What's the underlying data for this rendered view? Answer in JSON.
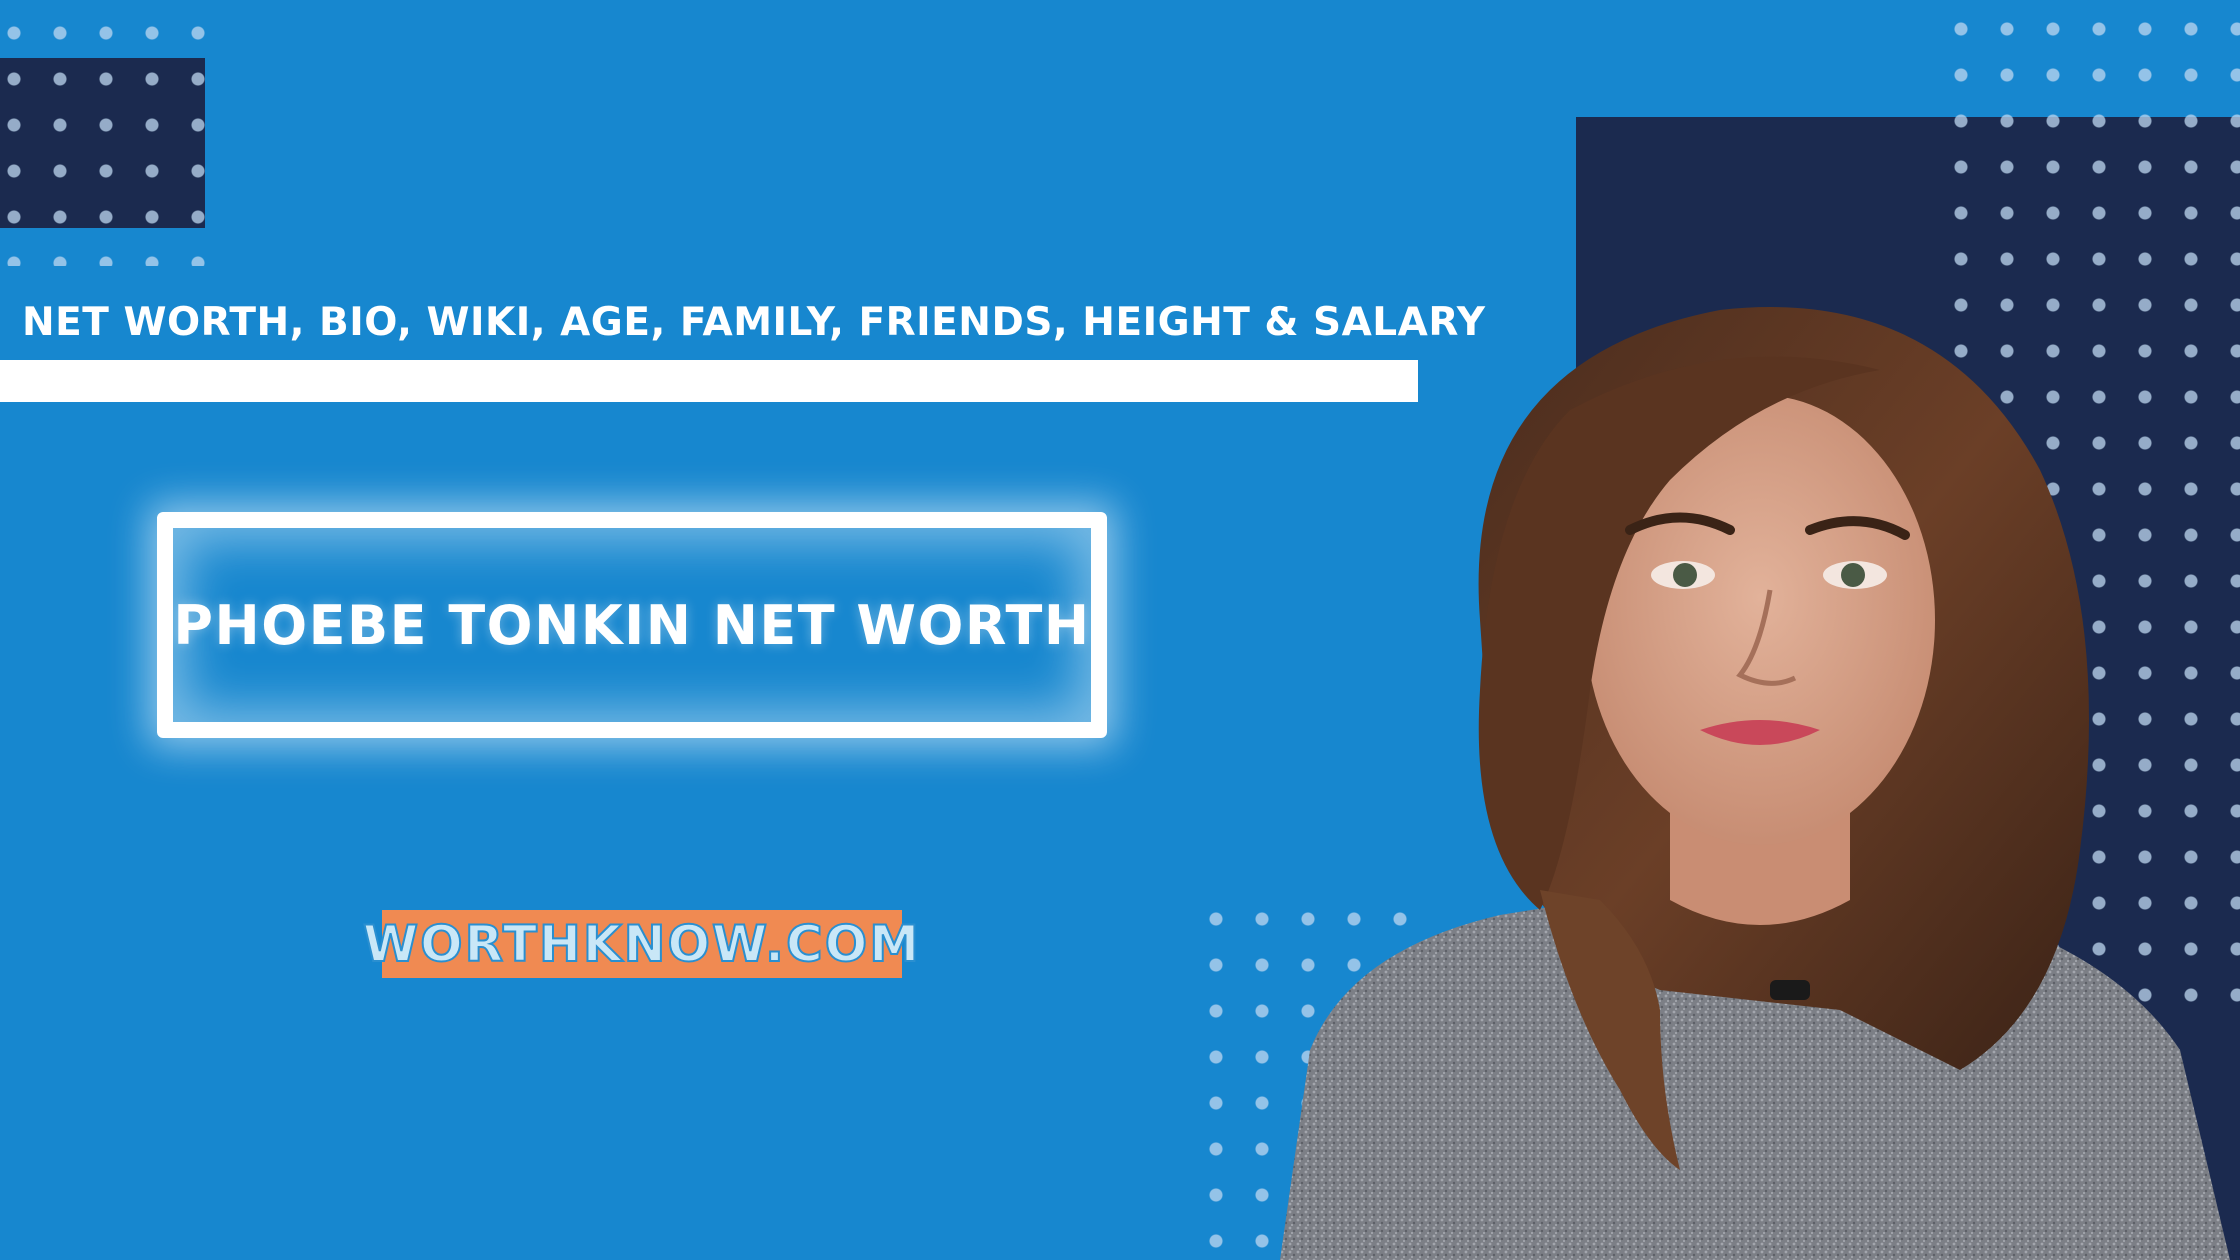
{
  "headline": "NET WORTH, BIO, WIKI, AGE, FAMILY, FRIENDS, HEIGHT & SALARY",
  "title": "PHOEBE TONKIN NET WORTH",
  "site": "WORTHKNOW.COM",
  "colors": {
    "background": "#1787cf",
    "navy": "#1b2a4f",
    "white": "#ffffff",
    "badge": "#f08a52"
  },
  "portrait": {
    "icon": "person-portrait-icon"
  }
}
